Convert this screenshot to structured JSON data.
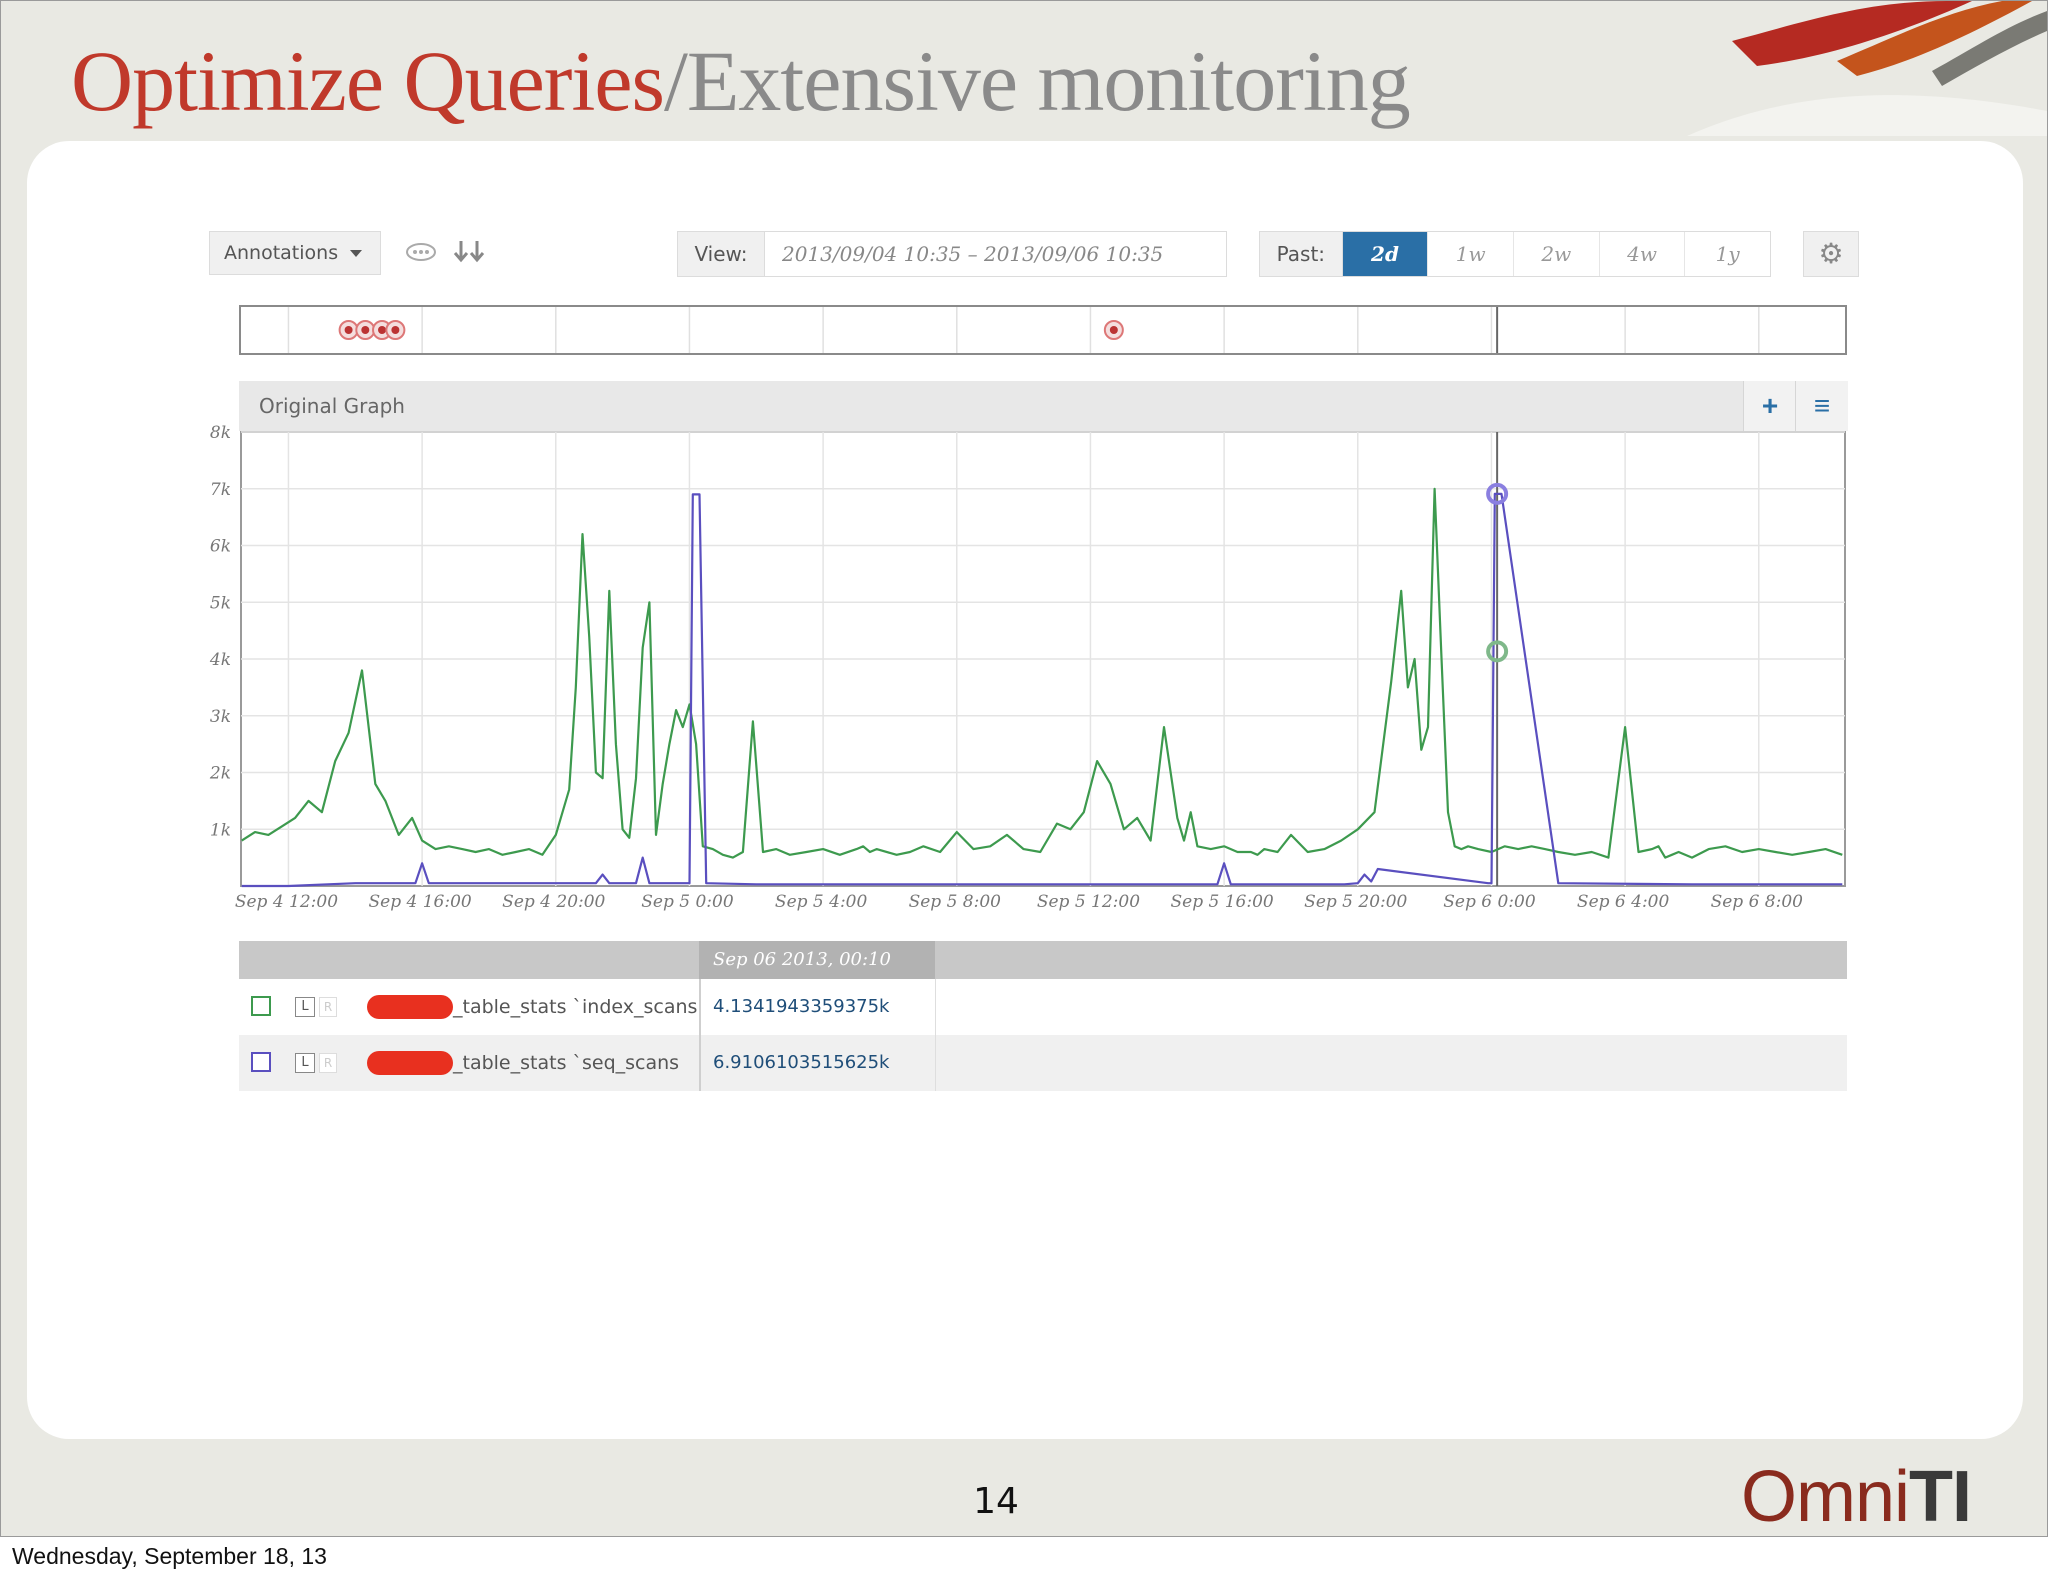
{
  "slide": {
    "title_red": "Optimize Queries",
    "title_grey": "/Extensive monitoring",
    "page_number": "14",
    "footer_date": "Wednesday, September 18, 13",
    "logo_prefix": "Omni",
    "logo_suffix": "TI"
  },
  "toolbar": {
    "annotations_label": "Annotations",
    "view_label": "View:",
    "view_range": "2013/09/04 10:35  –  2013/09/06 10:35",
    "past_label": "Past:",
    "past_options": [
      "2d",
      "1w",
      "2w",
      "4w",
      "1y"
    ],
    "past_selected": "2d",
    "icons": [
      "annotation-toggle-icon",
      "collapse-arrows-icon",
      "gear-icon"
    ]
  },
  "graph": {
    "title": "Original Graph",
    "add_label": "+",
    "menu_label": "≡"
  },
  "legend": {
    "hover_date": "Sep 06 2013, 00:10",
    "rows": [
      {
        "metric": "_table_stats `index_scans",
        "value": "4.1341943359375k",
        "color": "#3d9a4e"
      },
      {
        "metric": "_table_stats `seq_scans",
        "value": "6.9106103515625k",
        "color": "#5a4fbf"
      }
    ],
    "l_label": "L",
    "r_label": "R"
  },
  "colors": {
    "title_red": "#c0392b",
    "title_grey": "#8a8a8a",
    "accent_blue": "#2a6fa6",
    "series_green": "#3d9a4e",
    "series_purple": "#5a4fbf"
  },
  "chart_data": {
    "type": "line",
    "xlabel": "",
    "ylabel": "",
    "ylim": [
      0,
      8000
    ],
    "yticks": [
      "8k",
      "7k",
      "6k",
      "5k",
      "4k",
      "3k",
      "2k",
      "1k"
    ],
    "xtick_labels": [
      "Sep 4 12:00",
      "Sep 4 16:00",
      "Sep 4 20:00",
      "Sep 5 0:00",
      "Sep 5 4:00",
      "Sep 5 8:00",
      "Sep 5 12:00",
      "Sep 5 16:00",
      "Sep 5 20:00",
      "Sep 6 0:00",
      "Sep 6 4:00",
      "Sep 6 8:00"
    ],
    "x_hours_from_sep4_00": [
      12,
      16,
      20,
      24,
      28,
      32,
      36,
      40,
      44,
      48,
      52,
      56
    ],
    "x_range_hours": [
      10.58,
      58.58
    ],
    "grid": true,
    "annotation_markers_hours": [
      13.8,
      14.3,
      14.8,
      15.2,
      36.7
    ],
    "hover_x_hours": 48.17,
    "series": [
      {
        "name": "_table_stats `index_scans",
        "color": "#3d9a4e",
        "x": [
          10.6,
          11,
          11.4,
          11.8,
          12.2,
          12.6,
          13,
          13.4,
          13.8,
          14.2,
          14.6,
          14.9,
          15.3,
          15.7,
          16,
          16.4,
          16.8,
          17.2,
          17.6,
          18,
          18.4,
          18.8,
          19.2,
          19.6,
          20,
          20.4,
          20.6,
          20.8,
          21,
          21.2,
          21.4,
          21.6,
          21.8,
          22,
          22.2,
          22.4,
          22.6,
          22.8,
          23,
          23.2,
          23.4,
          23.6,
          23.8,
          24,
          24.2,
          24.4,
          24.7,
          25,
          25.3,
          25.6,
          25.9,
          26.2,
          26.6,
          27,
          27.5,
          28,
          28.5,
          29,
          29.2,
          29.4,
          29.6,
          30.2,
          30.6,
          31,
          31.5,
          32,
          32.5,
          33,
          33.5,
          34,
          34.5,
          35,
          35.4,
          35.8,
          36.2,
          36.6,
          37,
          37.4,
          37.8,
          38.2,
          38.6,
          38.8,
          39,
          39.2,
          39.6,
          40,
          40.4,
          40.8,
          41,
          41.2,
          41.6,
          42,
          42.5,
          43,
          43.5,
          44,
          44.5,
          45,
          45.3,
          45.5,
          45.7,
          45.9,
          46.1,
          46.3,
          46.5,
          46.7,
          46.9,
          47.1,
          47.3,
          47.6,
          48,
          48.4,
          48.8,
          49.2,
          49.6,
          50,
          50.5,
          51,
          51.5,
          52,
          52.4,
          52.8,
          53,
          53.2,
          53.4,
          53.6,
          54,
          54.5,
          55,
          55.5,
          56,
          56.5,
          57,
          57.5,
          58,
          58.5
        ],
        "y": [
          800,
          950,
          900,
          1050,
          1200,
          1500,
          1300,
          2200,
          2700,
          3800,
          1800,
          1500,
          900,
          1200,
          800,
          650,
          700,
          650,
          600,
          650,
          550,
          600,
          650,
          550,
          900,
          1700,
          3500,
          6200,
          4400,
          2000,
          1900,
          5200,
          2500,
          1000,
          850,
          1900,
          4200,
          5000,
          900,
          1800,
          2500,
          3100,
          2800,
          3200,
          2500,
          700,
          650,
          550,
          500,
          600,
          2900,
          600,
          650,
          550,
          600,
          650,
          550,
          650,
          700,
          600,
          650,
          550,
          600,
          700,
          600,
          950,
          650,
          700,
          900,
          650,
          600,
          1100,
          1000,
          1300,
          2200,
          1800,
          1000,
          1200,
          800,
          2800,
          1200,
          800,
          1300,
          700,
          650,
          700,
          600,
          600,
          550,
          650,
          600,
          900,
          600,
          650,
          800,
          1000,
          1300,
          3600,
          5200,
          3500,
          4000,
          2400,
          2800,
          7000,
          4100,
          1300,
          700,
          650,
          700,
          650,
          600,
          700,
          650,
          700,
          650,
          600,
          550,
          600,
          500,
          2800,
          600,
          650,
          700,
          500,
          550,
          600,
          500,
          650,
          700,
          600,
          650,
          600,
          550,
          600,
          650,
          550
        ]
      },
      {
        "name": "_table_stats `seq_scans",
        "color": "#5a4fbf",
        "x": [
          10.6,
          12,
          14,
          15.8,
          16,
          16.2,
          18,
          20,
          21.2,
          21.4,
          21.6,
          22.4,
          22.6,
          22.8,
          24,
          24.1,
          24.2,
          24.3,
          24.5,
          26,
          30,
          34,
          38,
          39.8,
          40,
          40.2,
          42,
          43.6,
          44,
          44.2,
          44.4,
          44.6,
          47.9,
          48,
          48.1,
          48.2,
          48.3,
          50,
          54,
          58.5
        ],
        "y": [
          0,
          0,
          50,
          50,
          400,
          50,
          50,
          50,
          50,
          200,
          50,
          50,
          500,
          50,
          50,
          6900,
          6900,
          6900,
          50,
          30,
          30,
          30,
          30,
          30,
          400,
          30,
          30,
          30,
          50,
          200,
          80,
          300,
          50,
          50,
          6910,
          6910,
          6910,
          50,
          30,
          30
        ]
      }
    ]
  }
}
